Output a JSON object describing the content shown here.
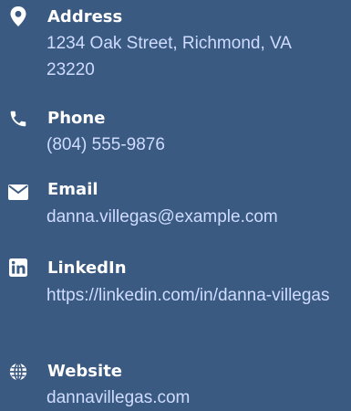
{
  "contacts": [
    {
      "icon": "map-pin-icon",
      "label": "Address",
      "value": "1234 Oak Street, Richmond, VA 23220"
    },
    {
      "icon": "phone-icon",
      "label": "Phone",
      "value": "(804) 555-9876"
    },
    {
      "icon": "envelope-icon",
      "label": "Email",
      "value": "danna.villegas@example.com"
    },
    {
      "icon": "linkedin-icon",
      "label": "LinkedIn",
      "value": "https://linkedin.com/in/danna-villegas"
    },
    {
      "icon": "globe-icon",
      "label": "Website",
      "value": "dannavillegas.com"
    }
  ],
  "colors": {
    "background": "#3a5a82",
    "label": "#ffffff",
    "value": "#cfdcff",
    "icon": "#ffffff"
  }
}
